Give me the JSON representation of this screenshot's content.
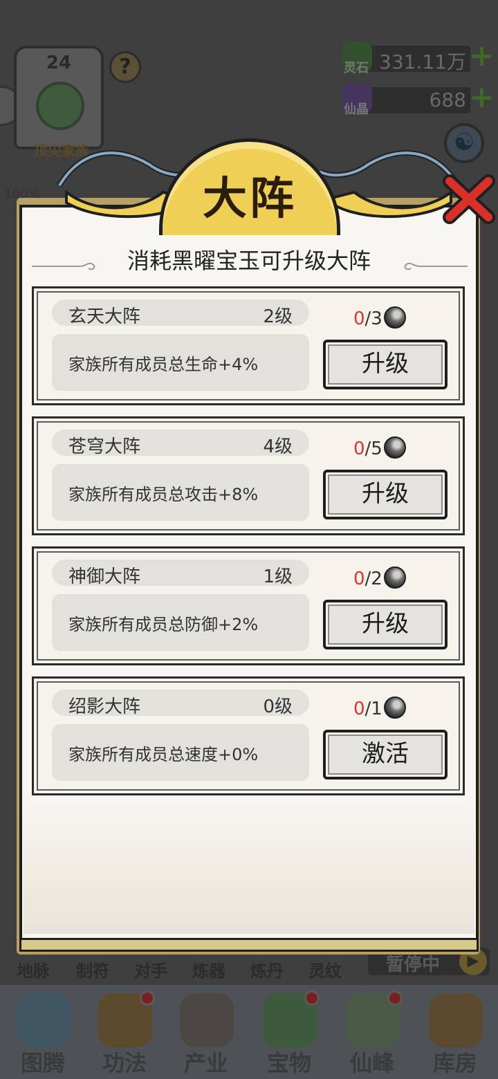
{
  "player": {
    "level": "24",
    "title": "顶尖家族",
    "progress_text": "100%"
  },
  "resources": [
    {
      "name": "灵石",
      "value": "331.11万",
      "icon": "spirit-stone-icon",
      "color": "#3d6b35"
    },
    {
      "name": "仙晶",
      "value": "688",
      "icon": "immortal-crystal-icon",
      "color": "#5a3d7a"
    }
  ],
  "sub_menu": [
    "地脉",
    "制符",
    "对手",
    "炼器",
    "炼丹",
    "灵纹"
  ],
  "pause": {
    "label": "暂停中"
  },
  "bottom_nav": [
    {
      "label": "图腾",
      "icon": "totem-icon",
      "badge": false
    },
    {
      "label": "功法",
      "icon": "technique-icon",
      "badge": true
    },
    {
      "label": "产业",
      "icon": "industry-icon",
      "badge": false
    },
    {
      "label": "宝物",
      "icon": "treasure-icon",
      "badge": true
    },
    {
      "label": "仙峰",
      "icon": "immortal-peak-icon",
      "badge": true
    },
    {
      "label": "库房",
      "icon": "storehouse-icon",
      "badge": false
    }
  ],
  "modal": {
    "title": "大阵",
    "subtitle": "消耗黑曜宝玉可升级大阵",
    "formations": [
      {
        "name": "玄天大阵",
        "level": "2级",
        "effect": "家族所有成员总生命+4%",
        "have": "0",
        "need": "/3",
        "button": "升级"
      },
      {
        "name": "苍穹大阵",
        "level": "4级",
        "effect": "家族所有成员总攻击+8%",
        "have": "0",
        "need": "/5",
        "button": "升级"
      },
      {
        "name": "神御大阵",
        "level": "1级",
        "effect": "家族所有成员总防御+2%",
        "have": "0",
        "need": "/2",
        "button": "升级"
      },
      {
        "name": "绍影大阵",
        "level": "0级",
        "effect": "家族所有成员总速度+0%",
        "have": "0",
        "need": "/1",
        "button": "激活"
      }
    ]
  },
  "colors": {
    "accent_gold": "#f0cf57",
    "cost_red": "#e0352b",
    "close_red": "#d9302a",
    "panel_bg": "#f7f6f1"
  }
}
